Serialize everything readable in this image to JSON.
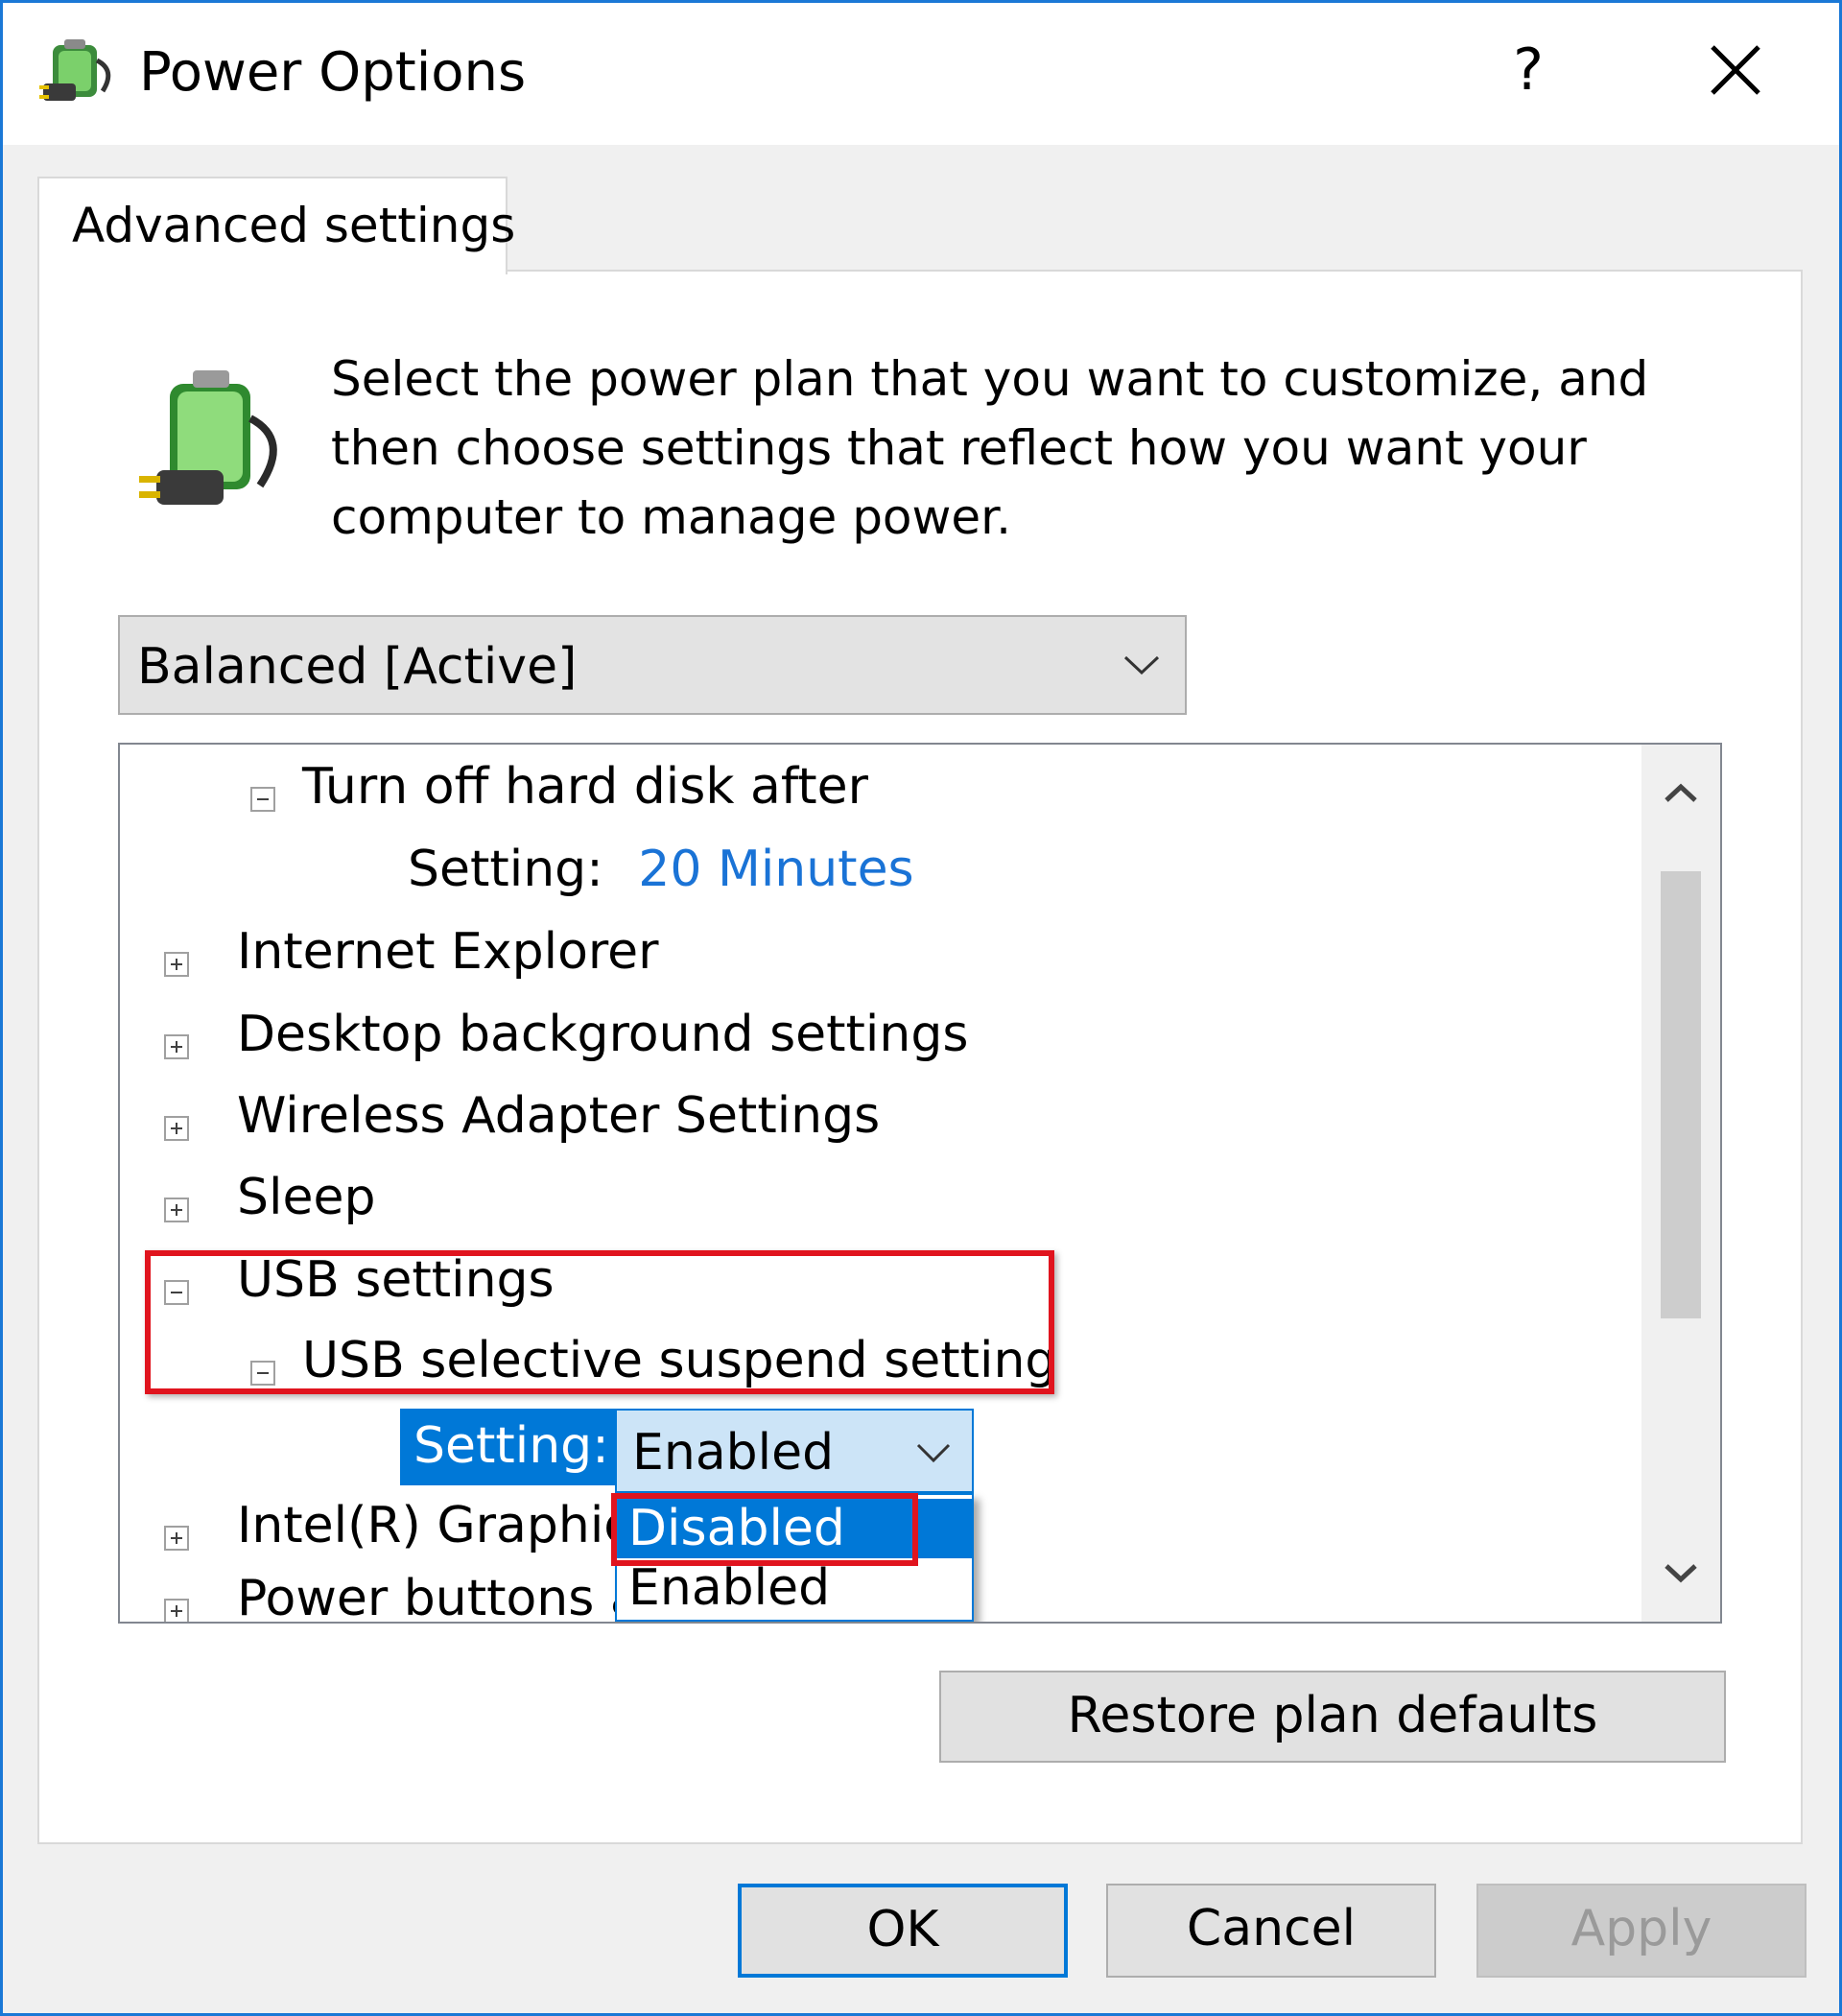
{
  "window": {
    "title": "Power Options",
    "help_label": "?",
    "accent": "#1a78d6"
  },
  "tabs": [
    {
      "label": "Advanced settings",
      "active": true
    }
  ],
  "intro": {
    "text": "Select the power plan that you want to customize, and then choose settings that reflect how you want your computer to manage power."
  },
  "plan": {
    "selected": "Balanced [Active]"
  },
  "tree": {
    "items": [
      {
        "label": "Turn off hard disk after",
        "expanded": true,
        "level": 1
      },
      {
        "setting_label": "Setting:",
        "setting_value": "20 Minutes"
      },
      {
        "label": "Internet Explorer",
        "expanded": false,
        "level": 0
      },
      {
        "label": "Desktop background settings",
        "expanded": false,
        "level": 0
      },
      {
        "label": "Wireless Adapter Settings",
        "expanded": false,
        "level": 0
      },
      {
        "label": "Sleep",
        "expanded": false,
        "level": 0
      },
      {
        "label": "USB settings",
        "expanded": true,
        "level": 0
      },
      {
        "label": "USB selective suspend setting",
        "expanded": true,
        "level": 1
      },
      {
        "label": "Intel(R) Graphic",
        "expanded": false,
        "level": 0
      },
      {
        "label": "Power buttons a",
        "expanded": false,
        "level": 0
      }
    ],
    "usb_setting": {
      "label": "Setting:",
      "value": "Enabled",
      "options": [
        "Disabled",
        "Enabled"
      ],
      "highlighted_option": "Disabled"
    }
  },
  "buttons": {
    "restore": "Restore plan defaults",
    "ok": "OK",
    "cancel": "Cancel",
    "apply": "Apply"
  },
  "colors": {
    "highlight_box": "#e0141e",
    "selection": "#0078d7",
    "link": "#1a73d6"
  }
}
